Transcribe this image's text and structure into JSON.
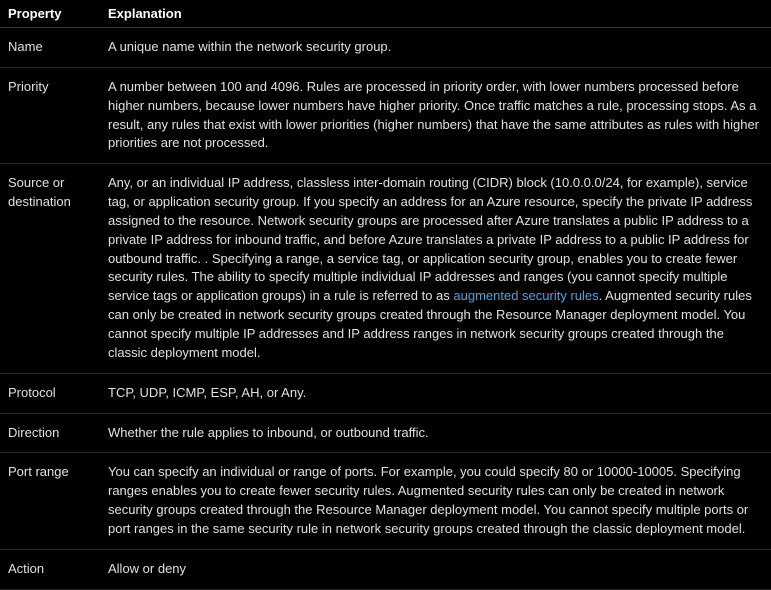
{
  "table": {
    "headers": {
      "property": "Property",
      "explanation": "Explanation"
    },
    "rows": [
      {
        "property": "Name",
        "explanation": "A unique name within the network security group."
      },
      {
        "property": "Priority",
        "explanation": "A number between 100 and 4096. Rules are processed in priority order, with lower numbers processed before higher numbers, because lower numbers have higher priority. Once traffic matches a rule, processing stops. As a result, any rules that exist with lower priorities (higher numbers) that have the same attributes as rules with higher priorities are not processed."
      },
      {
        "property": "Source or destination",
        "explanation_parts": {
          "before_link": "Any, or an individual IP address, classless inter-domain routing (CIDR) block (10.0.0.0/24, for example), service tag, or application security group. If you specify an address for an Azure resource, specify the private IP address assigned to the resource. Network security groups are processed after Azure translates a public IP address to a private IP address for inbound traffic, and before Azure translates a private IP address to a public IP address for outbound traffic. . Specifying a range, a service tag, or application security group, enables you to create fewer security rules. The ability to specify multiple individual IP addresses and ranges (you cannot specify multiple service tags or application groups) in a rule is referred to as ",
          "link_text": "augmented security rules",
          "after_link": ". Augmented security rules can only be created in network security groups created through the Resource Manager deployment model. You cannot specify multiple IP addresses and IP address ranges in network security groups created through the classic deployment model."
        }
      },
      {
        "property": "Protocol",
        "explanation": "TCP, UDP, ICMP, ESP, AH, or Any."
      },
      {
        "property": "Direction",
        "explanation": "Whether the rule applies to inbound, or outbound traffic."
      },
      {
        "property": "Port range",
        "explanation": "You can specify an individual or range of ports. For example, you could specify 80 or 10000-10005. Specifying ranges enables you to create fewer security rules. Augmented security rules can only be created in network security groups created through the Resource Manager deployment model. You cannot specify multiple ports or port ranges in the same security rule in network security groups created through the classic deployment model."
      },
      {
        "property": "Action",
        "explanation": "Allow or deny"
      }
    ]
  }
}
